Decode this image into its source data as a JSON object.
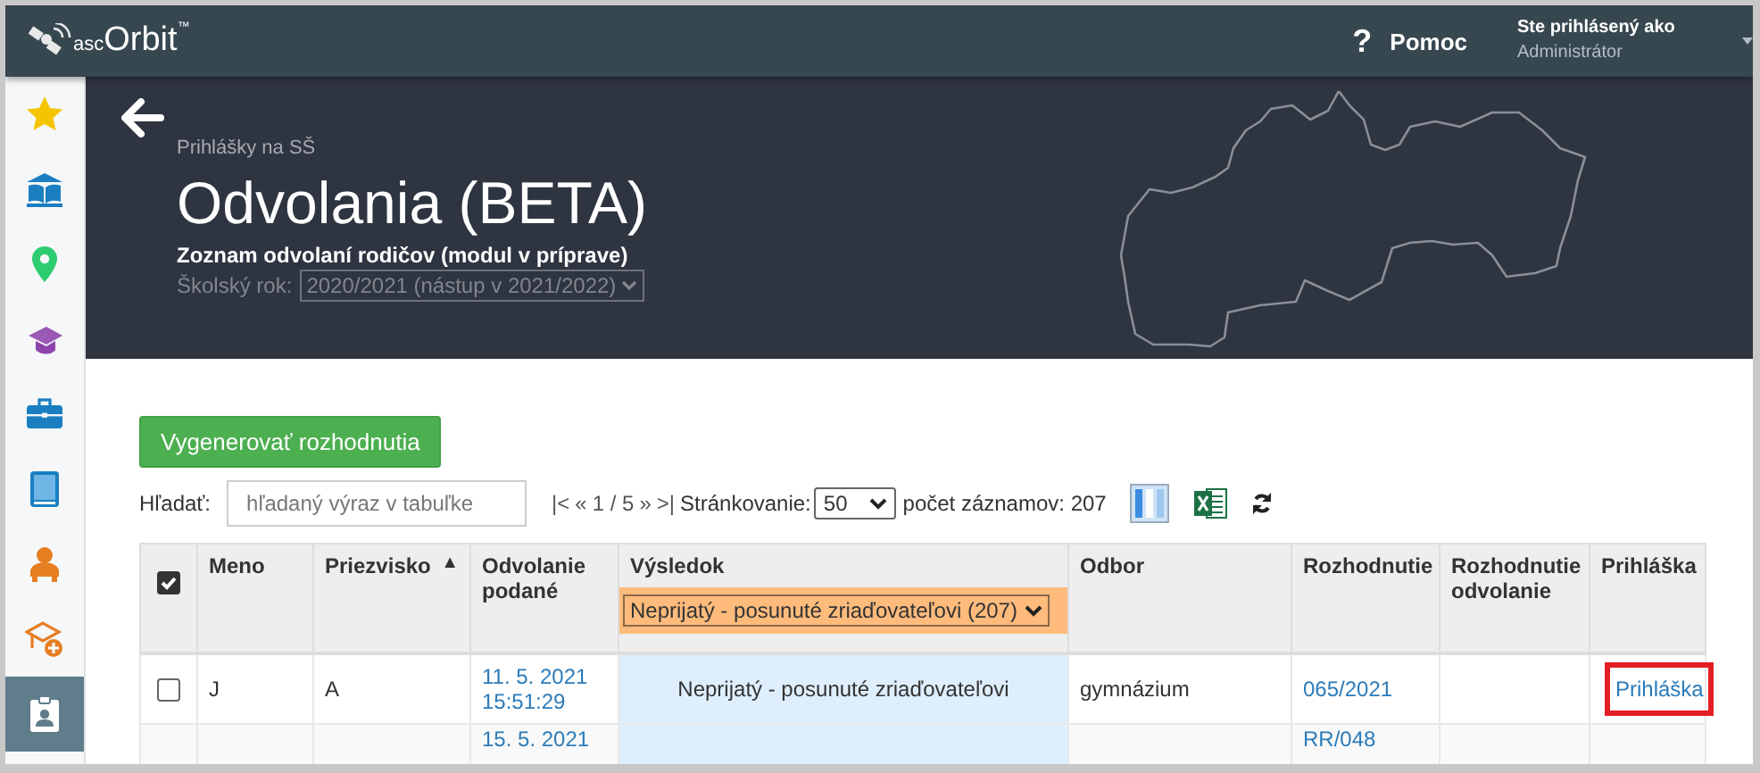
{
  "topbar": {
    "logo": {
      "prefix": "asc",
      "name": "Orbit",
      "mark": "™"
    },
    "help_icon": "?",
    "help": "Pomoc",
    "user_label": "Ste prihlásený ako",
    "user_name": "Administrátor"
  },
  "sidebar": {
    "items": [
      {
        "selected": false
      },
      {
        "selected": false
      },
      {
        "selected": false
      },
      {
        "selected": false
      },
      {
        "selected": false
      },
      {
        "selected": false
      },
      {
        "selected": false
      },
      {
        "selected": false
      },
      {
        "selected": true
      }
    ]
  },
  "header": {
    "breadcrumb": "Prihlášky na SŠ",
    "title": "Odvolania (BETA)",
    "subtitle": "Zoznam odvolaní rodičov (modul v príprave)",
    "year_label": "Školský rok:",
    "year_value": "2020/2021 (nástup v 2021/2022)"
  },
  "actions": {
    "generate_button": "Vygenerovať rozhodnutia"
  },
  "toolbar": {
    "search_label": "Hľadať:",
    "search_placeholder": "hľadaný výraz v tabuľke",
    "pager": {
      "first": "|<",
      "prev": "«",
      "page": "1 / 5",
      "next": "»",
      "last": ">|"
    },
    "page_size_label": "Stránkovanie:",
    "page_size": "50",
    "record_count": "počet záznamov: 207"
  },
  "table": {
    "select_all_checked": true,
    "columns": [
      {
        "label": "Meno"
      },
      {
        "label": "Priezvisko",
        "sort_indicator": "▲"
      },
      {
        "label": "Odvolanie podané"
      },
      {
        "label": "Výsledok",
        "filter": "Neprijatý - posunuté zriaďovateľovi (207)"
      },
      {
        "label": "Odbor"
      },
      {
        "label": "Rozhodnutie"
      },
      {
        "label": "Rozhodnutie odvolanie"
      },
      {
        "label": "Prihláška"
      }
    ],
    "rows": [
      {
        "checked": false,
        "meno": "J",
        "priezvisko": "A",
        "odvolanie": [
          "11. 5. 2021",
          "15:51:29"
        ],
        "vysledok": "Neprijatý - posunuté zriaďovateľovi",
        "odbor": "gymnázium",
        "rozhodnutie": "065/2021",
        "prihlaska": {
          "text": "Prihláška",
          "highlighted": true
        }
      },
      {
        "odvolanie": [
          "15. 5. 2021"
        ],
        "rozhodnutie": "RR/048"
      }
    ]
  }
}
